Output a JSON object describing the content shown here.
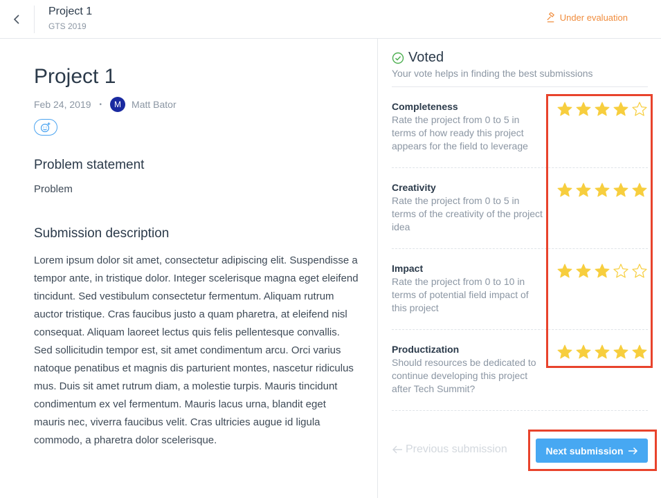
{
  "header": {
    "title": "Project 1",
    "subtitle": "GTS 2019",
    "status": "Under evaluation",
    "status_color": "#f08c3c"
  },
  "submission": {
    "title": "Project 1",
    "date": "Feb 24, 2019",
    "author_initial": "M",
    "author": "Matt Bator",
    "problem_heading": "Problem statement",
    "problem_text": "Problem",
    "description_heading": "Submission description",
    "description": "Lorem ipsum dolor sit amet, consectetur adipiscing elit. Suspendisse a tempor ante, in tristique dolor. Integer scelerisque magna eget eleifend tincidunt. Sed vestibulum consectetur fermentum. Aliquam rutrum auctor tristique. Cras faucibus justo a quam pharetra, at eleifend nisl consequat. Aliquam laoreet lectus quis felis pellentesque convallis. Sed sollicitudin tempor est, sit amet condimentum arcu. Orci varius natoque penatibus et magnis dis parturient montes, nascetur ridiculus mus. Duis sit amet rutrum diam, a molestie turpis. Mauris tincidunt condimentum ex vel fermentum. Mauris lacus urna, blandit eget mauris nec, viverra faucibus velit. Cras ultricies augue id ligula commodo, a pharetra dolor scelerisque."
  },
  "vote": {
    "title": "Voted",
    "subtitle": "Your vote helps in finding the best submissions",
    "criteria": [
      {
        "title": "Completeness",
        "description": "Rate the project from 0 to 5 in terms of how ready this project appears for the field to leverage",
        "rating": 4,
        "max": 5
      },
      {
        "title": "Creativity",
        "description": "Rate the project from 0 to 5 in terms of the creativity of the project idea",
        "rating": 5,
        "max": 5
      },
      {
        "title": "Impact",
        "description": "Rate the project from 0 to 10 in terms of potential field impact of this project",
        "rating": 3,
        "max": 5
      },
      {
        "title": "Productization",
        "description": "Should resources be dedicated to continue developing this project after Tech Summit?",
        "rating": 5,
        "max": 5
      }
    ]
  },
  "nav": {
    "previous_label": "Previous submission",
    "next_label": "Next submission"
  },
  "colors": {
    "star_filled": "#f7ce3e",
    "star_empty_stroke": "#f7ce3e",
    "primary_button": "#47a8f2",
    "highlight": "#e8432c",
    "voted_check": "#4caf50"
  }
}
